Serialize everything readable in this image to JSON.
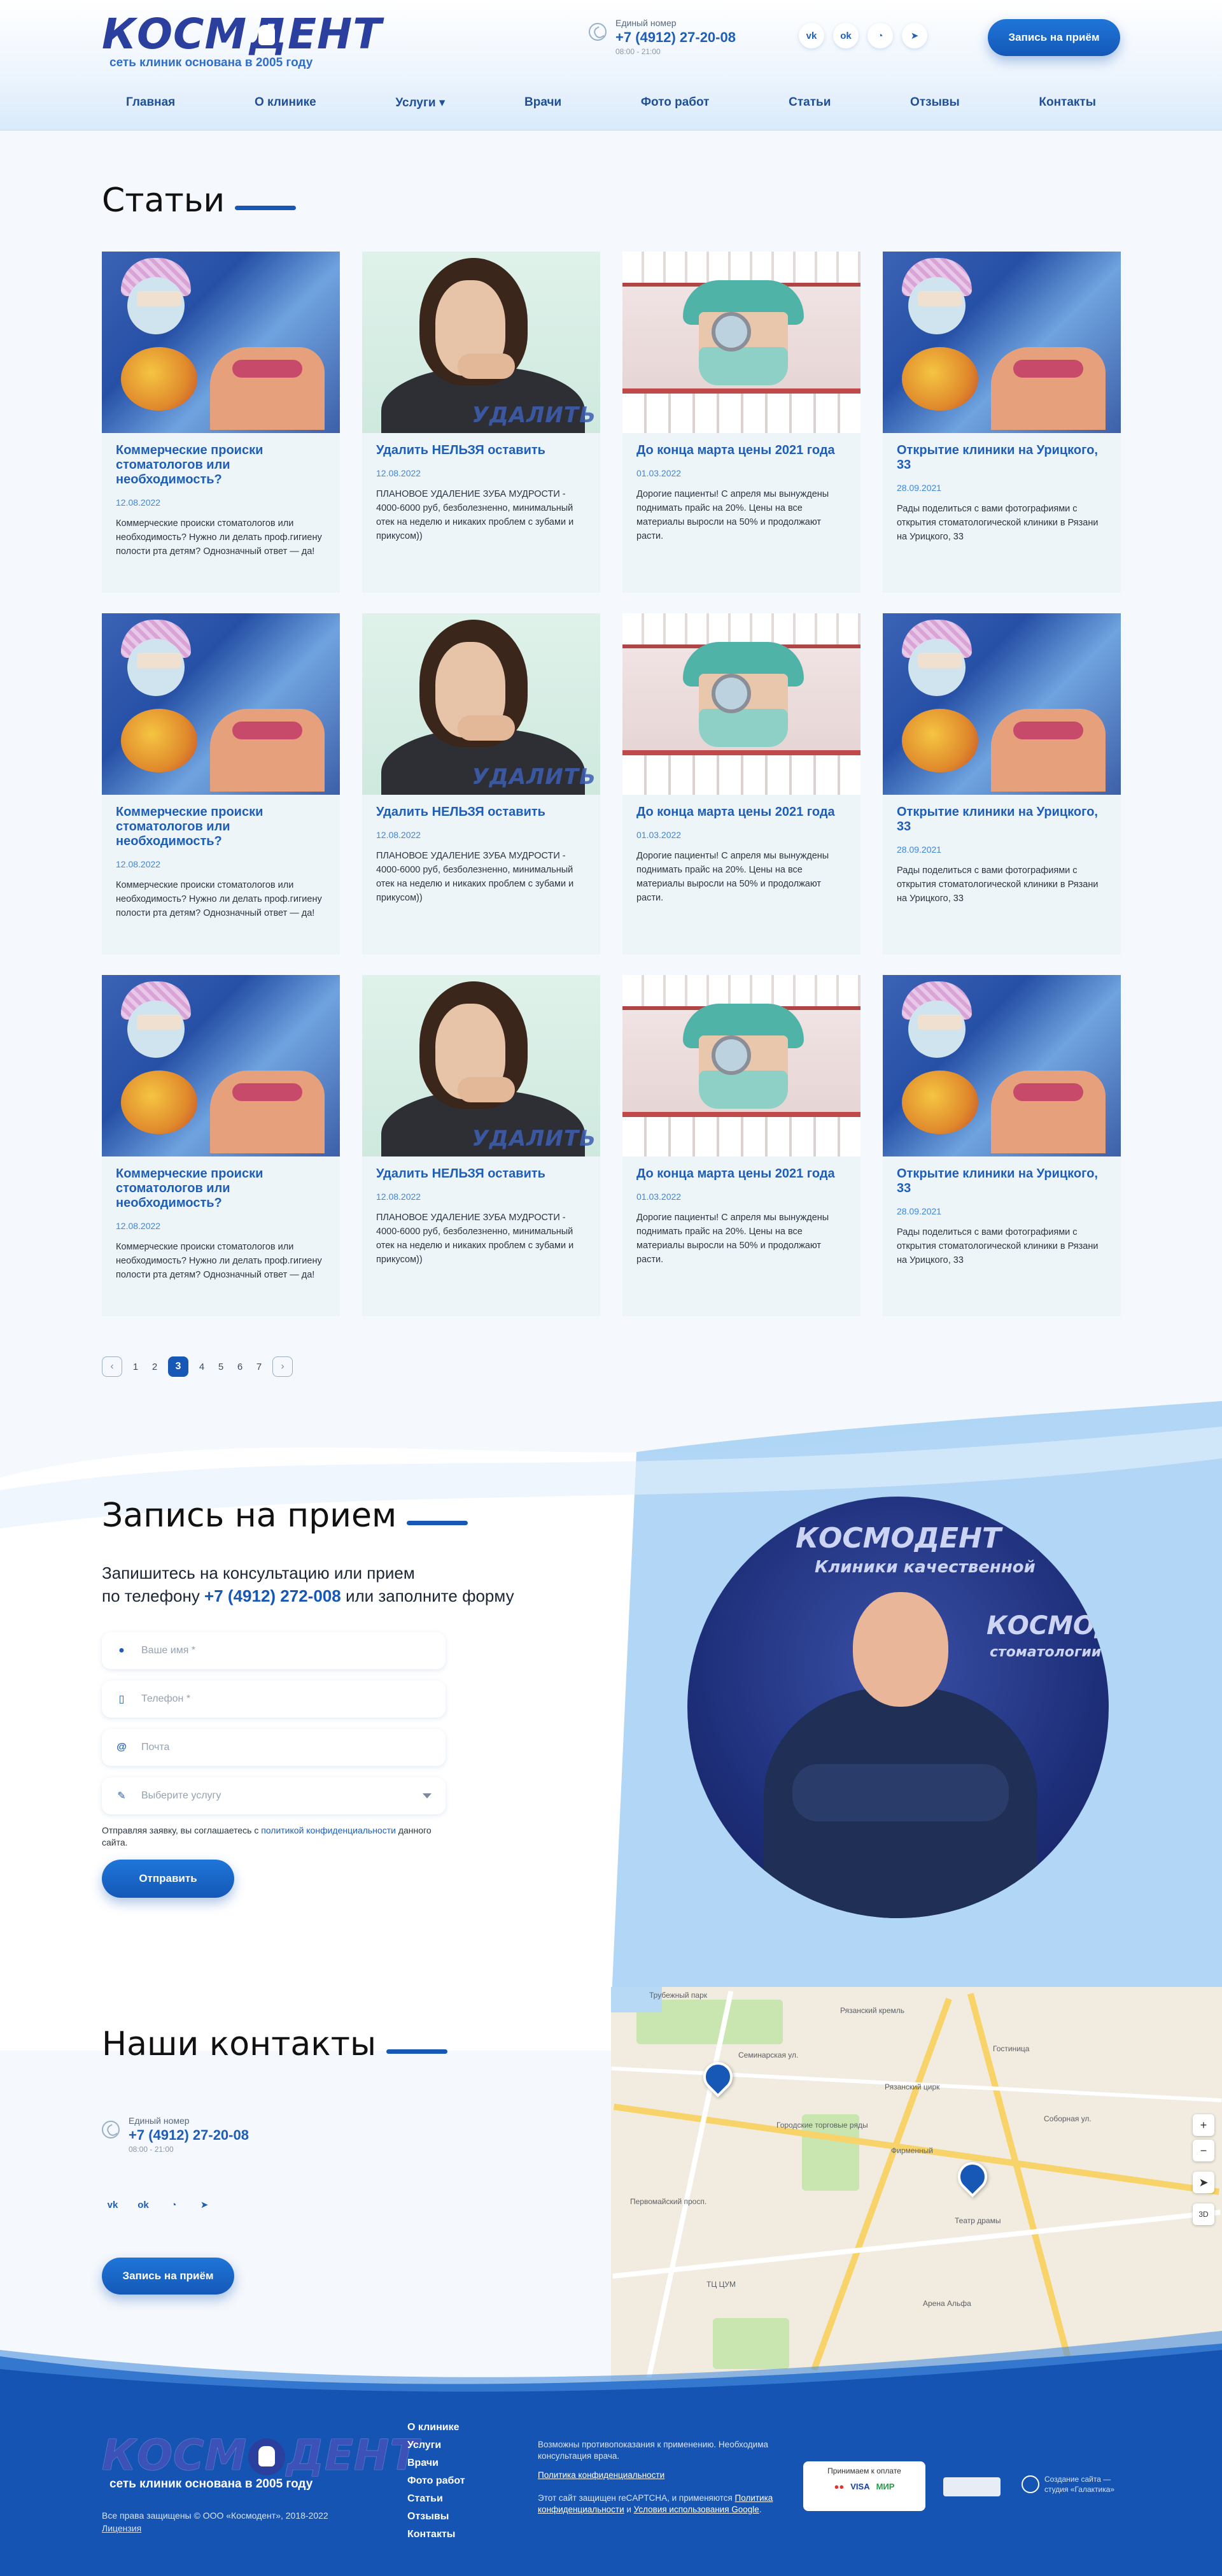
{
  "header": {
    "logo_text": "КОСМОДЕНТ",
    "logo_left": "КОСМ",
    "logo_right": "ДЕНТ",
    "tagline": "сеть клиник основана в 2005 году",
    "phone_label": "Единый номер",
    "phone": "+7 (4912) 27-20-08",
    "hours": "08:00 - 21:00",
    "socials": [
      {
        "icon": "vk-icon",
        "glyph": "vk"
      },
      {
        "icon": "ok-icon",
        "glyph": "ok"
      },
      {
        "icon": "whatsapp-icon",
        "glyph": "◔"
      },
      {
        "icon": "telegram-icon",
        "glyph": "➤"
      }
    ],
    "cta": "Запись на приём"
  },
  "nav": [
    {
      "label": "Главная"
    },
    {
      "label": "О клинике"
    },
    {
      "label": "Услуги ▾"
    },
    {
      "label": "Врачи"
    },
    {
      "label": "Фото работ"
    },
    {
      "label": "Статьи"
    },
    {
      "label": "Отзывы"
    },
    {
      "label": "Контакты"
    }
  ],
  "articles": {
    "title": "Статьи",
    "cards": [
      {
        "kind": "dentist",
        "title": "Коммерческие происки стоматологов или необходимость?",
        "date": "12.08.2022",
        "text": "Коммерческие происки стоматологов или необходимость? Нужно ли делать проф.гигиену полости рта детям? Однозначный ответ — да!"
      },
      {
        "kind": "woman",
        "title": "Удалить НЕЛЬЗЯ оставить",
        "date": "12.08.2022",
        "text": "ПЛАНОВОЕ УДАЛЕНИЕ ЗУБА МУДРОСТИ - 4000-6000 руб, безболезненно, минимальный отек на неделю и никаких проблем с зубами и прикусом))",
        "stamp": "УДАЛИТЬ"
      },
      {
        "kind": "doctor",
        "title": "До конца марта цены 2021 года",
        "date": "01.03.2022",
        "text": "Дорогие пациенты! С апреля мы вынуждены поднимать прайс на 20%. Цены на все материалы выросли на 50% и продолжают расти."
      },
      {
        "kind": "dentist",
        "title": "Открытие клиники на Урицкого, 33",
        "date": "28.09.2021",
        "text": "Рады поделиться с вами фотографиями с открытия стоматологической клиники в Рязани на Урицкого, 33"
      },
      {
        "kind": "dentist",
        "title": "Коммерческие происки стоматологов или необходимость?",
        "date": "12.08.2022",
        "text": "Коммерческие происки стоматологов или необходимость? Нужно ли делать проф.гигиену полости рта детям? Однозначный ответ — да!"
      },
      {
        "kind": "woman",
        "title": "Удалить НЕЛЬЗЯ оставить",
        "date": "12.08.2022",
        "text": "ПЛАНОВОЕ УДАЛЕНИЕ ЗУБА МУДРОСТИ - 4000-6000 руб, безболезненно, минимальный отек на неделю и никаких проблем с зубами и прикусом))",
        "stamp": "УДАЛИТЬ"
      },
      {
        "kind": "doctor",
        "title": "До конца марта цены 2021 года",
        "date": "01.03.2022",
        "text": "Дорогие пациенты! С апреля мы вынуждены поднимать прайс на 20%. Цены на все материалы выросли на 50% и продолжают расти."
      },
      {
        "kind": "dentist",
        "title": "Открытие клиники на Урицкого, 33",
        "date": "28.09.2021",
        "text": "Рады поделиться с вами фотографиями с открытия стоматологической клиники в Рязани на Урицкого, 33"
      },
      {
        "kind": "dentist",
        "title": "Коммерческие происки стоматологов или необходимость?",
        "date": "12.08.2022",
        "text": "Коммерческие происки стоматологов или необходимость? Нужно ли делать проф.гигиену полости рта детям? Однозначный ответ — да!"
      },
      {
        "kind": "woman",
        "title": "Удалить НЕЛЬЗЯ оставить",
        "date": "12.08.2022",
        "text": "ПЛАНОВОЕ УДАЛЕНИЕ ЗУБА МУДРОСТИ - 4000-6000 руб, безболезненно, минимальный отек на неделю и никаких проблем с зубами и прикусом))",
        "stamp": "УДАЛИТЬ"
      },
      {
        "kind": "doctor",
        "title": "До конца марта цены 2021 года",
        "date": "01.03.2022",
        "text": "Дорогие пациенты! С апреля мы вынуждены поднимать прайс на 20%. Цены на все материалы выросли на 50% и продолжают расти."
      },
      {
        "kind": "dentist",
        "title": "Открытие клиники на Урицкого, 33",
        "date": "28.09.2021",
        "text": "Рады поделиться с вами фотографиями с открытия стоматологической клиники в Рязани на Урицкого, 33"
      }
    ]
  },
  "pagination": {
    "prev": "‹",
    "next": "›",
    "pages": [
      "1",
      "2",
      "3",
      "4",
      "5",
      "6",
      "7"
    ],
    "active": "3"
  },
  "appointment": {
    "title": "Запись на прием",
    "lead_1": "Запишитесь на консультацию или прием",
    "lead_2_prefix": "по телефону ",
    "lead_phone": "+7 (4912) 272-008",
    "lead_2_suffix": " или заполните форму",
    "fields": {
      "name": "Ваше имя *",
      "phone": "Телефон *",
      "email": "Почта",
      "service": "Выберите услугу"
    },
    "agree_prefix": "Отправляя заявку, вы соглашаетесь с ",
    "agree_link": "политикой конфиденциальности",
    "agree_suffix": " данного сайта.",
    "submit": "Отправить",
    "photo_text_1": "КОСМОДЕНТ",
    "photo_text_2": "Клиники качественной",
    "photo_text_3": "стоматологии"
  },
  "contacts": {
    "title": "Наши контакты",
    "phone_label": "Единый номер",
    "phone": "+7 (4912) 27-20-08",
    "hours": "08:00 - 21:00",
    "cta": "Запись на приём",
    "map_labels": [
      "Трубежный парк",
      "Рязанский кремль",
      "Семинарская ул.",
      "Рязанский цирк",
      "Городские торговые ряды",
      "Первомайский просп.",
      "Театр драмы",
      "Фирменный",
      "Гостиница",
      "Арена Альфа",
      "Соборная ул.",
      "ТЦ ЦУМ"
    ],
    "map_controls": [
      "+",
      "−",
      "➤",
      "3D"
    ]
  },
  "footer": {
    "menu": [
      "О клинике",
      "Услуги",
      "Врачи",
      "Фото работ",
      "Статьи",
      "Отзывы",
      "Контакты"
    ],
    "copyright": "Все права защищены © ООО «Космодент», 2018-2022",
    "license": "Лицензия",
    "warning": "Возможны противопоказания к применению. Необходима консультация врача.",
    "privacy": "Политика конфиденциальности",
    "recaptcha_1": "Этот сайт защищен reCAPTCHA, и применяются ",
    "recaptcha_link1": "Политика конфиденциальности",
    "recaptcha_2": " и ",
    "recaptcha_link2": "Условия использования Google",
    "recaptcha_3": ".",
    "pay_title": "Принимаем к оплате",
    "pay_cards": [
      "●●",
      "VISA",
      "МИР"
    ],
    "studio": "Создание сайта — студия «Галактика»"
  },
  "colors": {
    "brand_blue": "#1757b5",
    "logo_blue": "#2b3f9e",
    "footer_blue": "#1554b3"
  }
}
